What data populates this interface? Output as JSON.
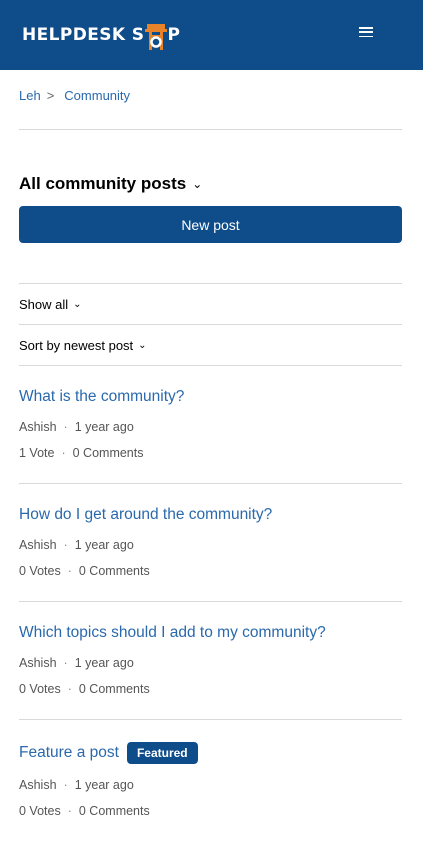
{
  "header": {
    "logo_left": "HELPDESK S",
    "logo_right": "P"
  },
  "breadcrumb": {
    "home": "Leh",
    "separator": ">",
    "current": "Community"
  },
  "page": {
    "title": "All community posts",
    "new_post_label": "New post",
    "filter_label": "Show all",
    "sort_label": "Sort by newest post"
  },
  "posts": [
    {
      "title": "What is the community?",
      "author": "Ashish",
      "time": "1 year ago",
      "votes": "1 Vote",
      "comments": "0 Comments"
    },
    {
      "title": "How do I get around the community?",
      "author": "Ashish",
      "time": "1 year ago",
      "votes": "0 Votes",
      "comments": "0 Comments"
    },
    {
      "title": "Which topics should I add to my community?",
      "author": "Ashish",
      "time": "1 year ago",
      "votes": "0 Votes",
      "comments": "0 Comments"
    },
    {
      "title": "Feature a post",
      "badge": "Featured",
      "author": "Ashish",
      "time": "1 year ago",
      "votes": "0 Votes",
      "comments": "0 Comments"
    }
  ],
  "colors": {
    "brand": "#0f4c8a",
    "link": "#2a69ac",
    "logo_accent": "#e8832a"
  }
}
